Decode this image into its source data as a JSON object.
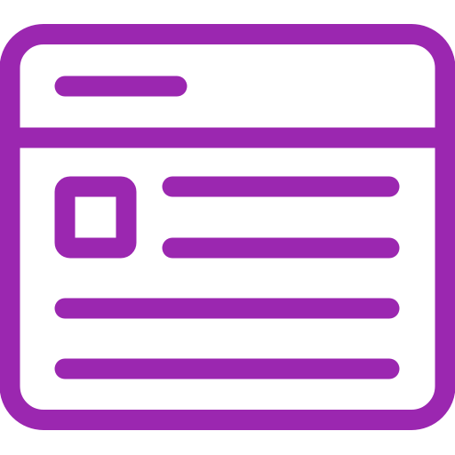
{
  "icon": {
    "name": "browser-window-article-icon",
    "stroke_color": "#9b27b0",
    "background_color": "#ffffff"
  }
}
